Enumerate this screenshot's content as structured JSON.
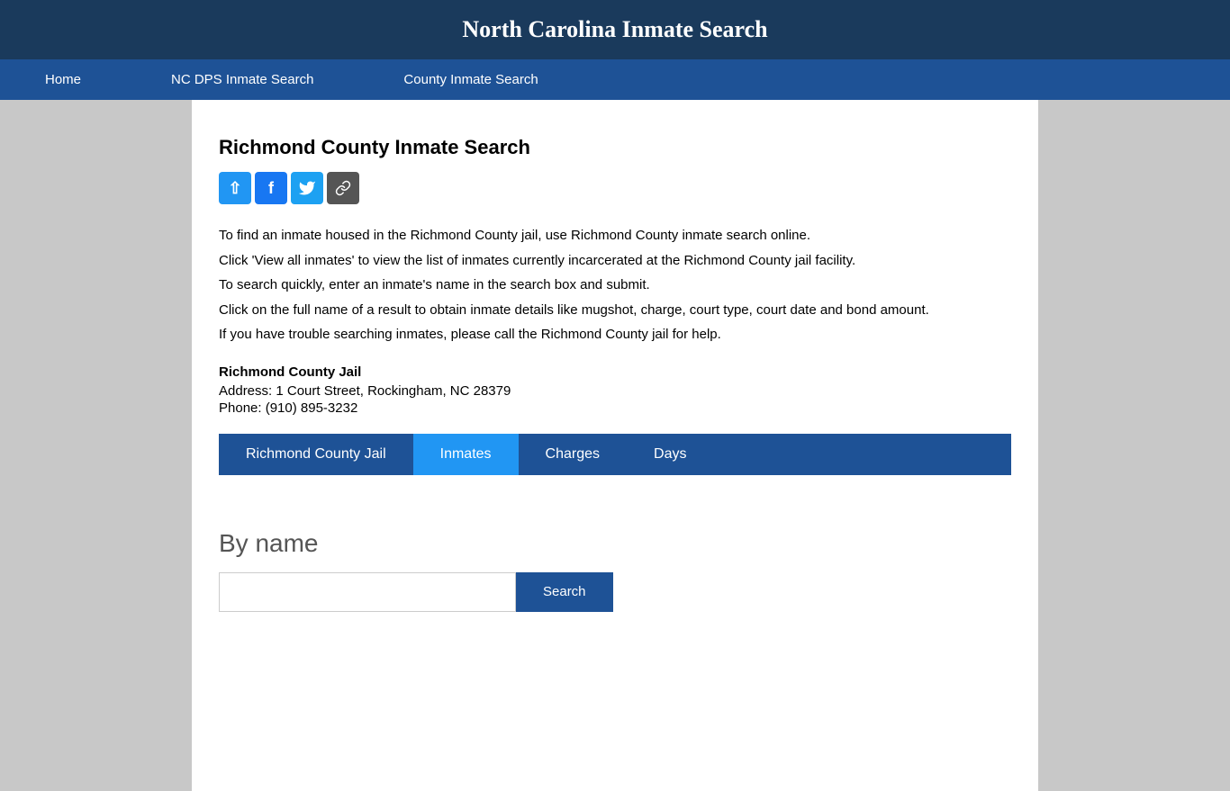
{
  "site": {
    "title": "North Carolina Inmate Search"
  },
  "nav": {
    "items": [
      {
        "label": "Home",
        "href": "#"
      },
      {
        "label": "NC DPS Inmate Search",
        "href": "#"
      },
      {
        "label": "County Inmate Search",
        "href": "#"
      }
    ]
  },
  "page": {
    "title": "Richmond County Inmate Search"
  },
  "social": {
    "share_label": "⇧",
    "facebook_label": "f",
    "twitter_label": "🐦",
    "link_label": "🔗"
  },
  "description": {
    "line1": "To find an inmate housed in the Richmond County jail, use Richmond County inmate search online.",
    "line2": "Click 'View all inmates' to view the list of inmates currently incarcerated at the Richmond County jail facility.",
    "line3": "To search quickly, enter an inmate's name in the search box and submit.",
    "line4": "Click on the full name of a result to obtain inmate details like mugshot, charge, court type, court date and bond amount.",
    "line5": "If you have trouble searching inmates, please call the Richmond County jail for help."
  },
  "jail": {
    "name": "Richmond County Jail",
    "address_label": "Address:",
    "address_value": "1 Court Street, Rockingham, NC 28379",
    "phone_label": "Phone:",
    "phone_value": "(910) 895-3232"
  },
  "tabs": [
    {
      "label": "Richmond County Jail",
      "active": false
    },
    {
      "label": "Inmates",
      "active": true
    },
    {
      "label": "Charges",
      "active": false
    },
    {
      "label": "Days",
      "active": false
    }
  ],
  "search": {
    "heading": "By name",
    "placeholder": "",
    "button_label": "Search"
  }
}
